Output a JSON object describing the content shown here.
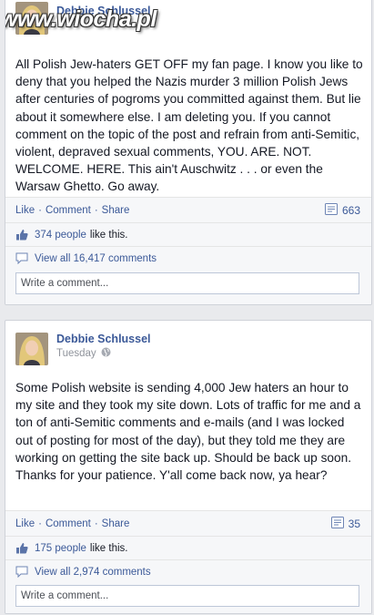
{
  "watermark": "www.wiocha.pl",
  "colors": {
    "link": "#3b5998",
    "background": "#e9eaed"
  },
  "posts": [
    {
      "author": "Debbie Schlussel",
      "text": "All Polish Jew-haters GET OFF my fan page. I know you like to deny that you helped the Nazis murder 3 million Polish Jews after centuries of pogroms you committed against them. But lie about it somewhere else. I am deleting you. If you cannot comment on the topic of the post and refrain from anti-Semitic, violent, depraved sexual comments, YOU. ARE. NOT. WELCOME. HERE. This ain't Auschwitz . . . or even the Warsaw Ghetto. Go away.",
      "actions": {
        "like": "Like",
        "comment": "Comment",
        "share": "Share",
        "sep": "·"
      },
      "share_count": "663",
      "likes_link": "374 people",
      "likes_suffix": "like this.",
      "view_comments": "View all 16,417 comments",
      "comment_placeholder": "Write a comment..."
    },
    {
      "author": "Debbie Schlussel",
      "timestamp": "Tuesday",
      "text": "Some Polish website is sending 4,000 Jew haters an hour to my site and they took my site down. Lots of traffic for me and a ton of anti-Semitic comments and e-mails (and I was locked out of posting for most of the day), but they told me they are working on getting the site back up. Should be back up soon. Thanks for your patience. Y'all come back now, ya hear?",
      "actions": {
        "like": "Like",
        "comment": "Comment",
        "share": "Share",
        "sep": "·"
      },
      "share_count": "35",
      "likes_link": "175 people",
      "likes_suffix": "like this.",
      "view_comments": "View all 2,974 comments",
      "comment_placeholder": "Write a comment..."
    }
  ]
}
